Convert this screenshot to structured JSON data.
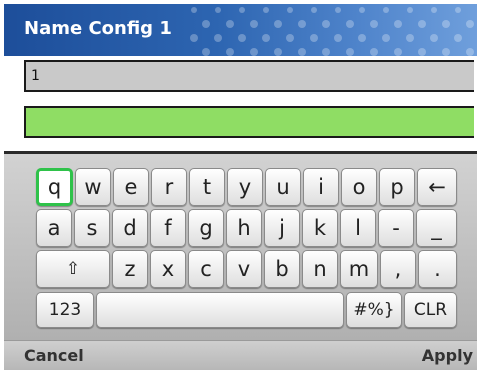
{
  "title": "Name Config 1",
  "fields": {
    "name_value": "1",
    "input_value": ""
  },
  "keyboard": {
    "row1": [
      "q",
      "w",
      "e",
      "r",
      "t",
      "y",
      "u",
      "i",
      "o",
      "p",
      "←"
    ],
    "row2": [
      "a",
      "s",
      "d",
      "f",
      "g",
      "h",
      "j",
      "k",
      "l",
      "-",
      "_"
    ],
    "row3": [
      "⇧",
      "z",
      "x",
      "c",
      "v",
      "b",
      "n",
      "m",
      ",",
      "."
    ],
    "row4": [
      "123",
      "",
      "#%}",
      "CLR"
    ]
  },
  "softkeys": {
    "left": "Cancel",
    "right": "Apply"
  },
  "colors": {
    "titlebar": "#2d65b1",
    "active_field": "#8fdd64",
    "key_highlight": "#2fc24a"
  }
}
